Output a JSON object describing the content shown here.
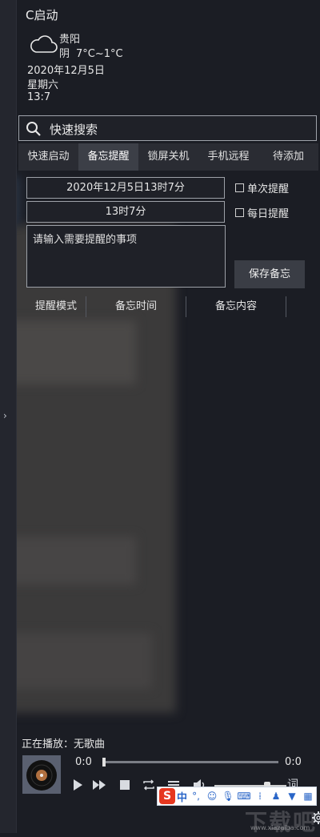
{
  "app": {
    "title": "C启动"
  },
  "weather": {
    "icon": "cloud-icon",
    "city": "贵阳",
    "condition": "阴",
    "temperature": "7°C~1°C",
    "date": "2020年12月5日",
    "weekday": "星期六",
    "time": "13:7"
  },
  "search": {
    "label": "快速搜索"
  },
  "tabs": [
    {
      "label": "快速启动",
      "active": false
    },
    {
      "label": "备忘提醒",
      "active": true
    },
    {
      "label": "锁屏关机",
      "active": false
    },
    {
      "label": "手机远程",
      "active": false
    },
    {
      "label": "待添加",
      "active": false
    }
  ],
  "reminder": {
    "datetime": "2020年12月5日13时7分",
    "time": "13时7分",
    "content_placeholder": "请输入需要提醒的事项",
    "once_label": "单次提醒",
    "daily_label": "每日提醒",
    "save_label": "保存备忘"
  },
  "columns": [
    "提醒模式",
    "备忘时间",
    "备忘内容"
  ],
  "player": {
    "now_playing": "正在播放：无歌曲",
    "time_current": "0:0",
    "time_total": "0:0",
    "progress": 0,
    "volume": 0.73,
    "lyric_label": "词"
  },
  "ime": {
    "mode": "中",
    "punct": "°,"
  },
  "watermark": {
    "text": "下载吧",
    "url": "www.xiazaiba.com"
  },
  "colors": {
    "background": "#1b1d24",
    "active_tab": "#3c3f47",
    "button": "#3a3d45"
  }
}
